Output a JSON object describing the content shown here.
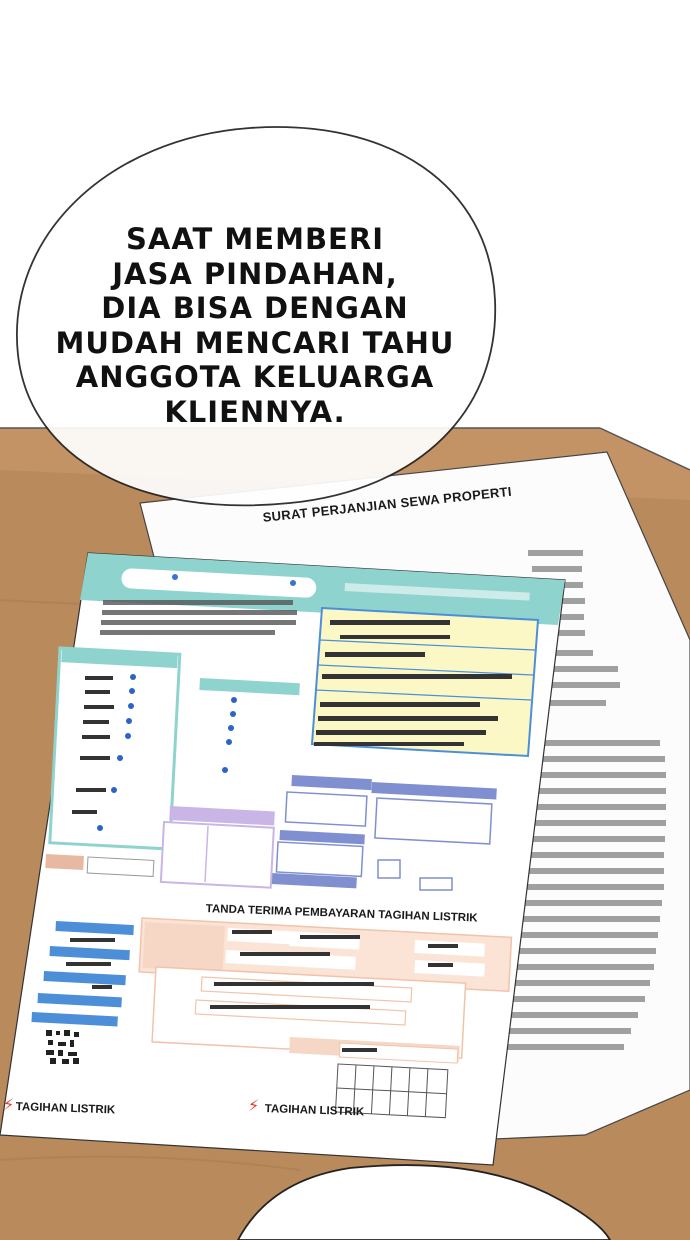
{
  "speech_bubble": {
    "text": "SAAT MEMBERI\nJASA PINDAHAN,\nDIA BISA DENGAN\nMUDAH MENCARI TAHU\nANGGOTA KELUARGA\nKLIENNYA."
  },
  "contract_document": {
    "title": "SURAT PERJANJIAN SEWA PROPERTI"
  },
  "electric_bill": {
    "receipt_title": "TANDA TERIMA PEMBAYARAN TAGIHAN LISTRIK",
    "footer_left": "TAGIHAN LISTRIK",
    "footer_right": "TAGIHAN LISTRIK",
    "bolt_icon": "lightning-bolt-icon"
  },
  "colors": {
    "table_wood": "#b98a5c",
    "bill_teal": "#8fd3cf",
    "bill_yellow": "#fbf8c6",
    "bill_blue": "#4c8fd8",
    "bill_peach": "#f6d7c6",
    "bill_purple": "#c9b5e6",
    "bolt_red": "#e23a2e"
  }
}
